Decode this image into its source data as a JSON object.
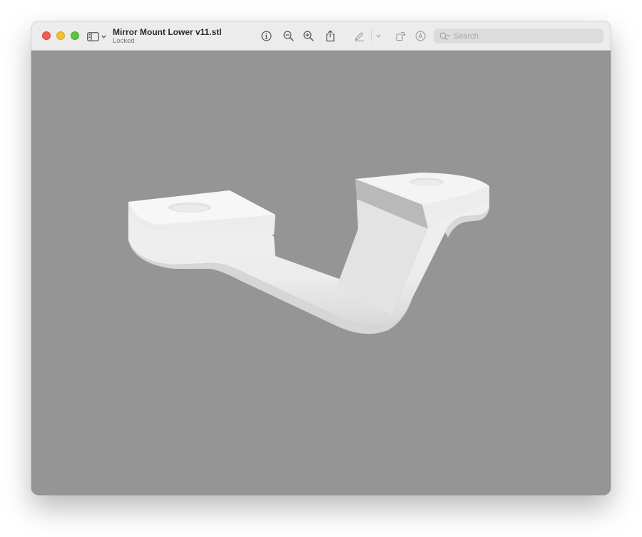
{
  "window": {
    "title": "Mirror Mount Lower v11.stl",
    "subtitle": "Locked"
  },
  "toolbar": {
    "icons": [
      "sidebar-icon",
      "info-icon",
      "zoom-out-icon",
      "zoom-in-icon",
      "share-icon",
      "markup-icon",
      "rotate-icon",
      "annotate-icon"
    ]
  },
  "search": {
    "placeholder": "Search",
    "value": ""
  },
  "viewport": {
    "background": "#959595",
    "model": "3D printed mirror mount bracket"
  },
  "colors": {
    "close": "#ee5f57",
    "minimize": "#f5bd2f",
    "maximize": "#5fc43f"
  }
}
